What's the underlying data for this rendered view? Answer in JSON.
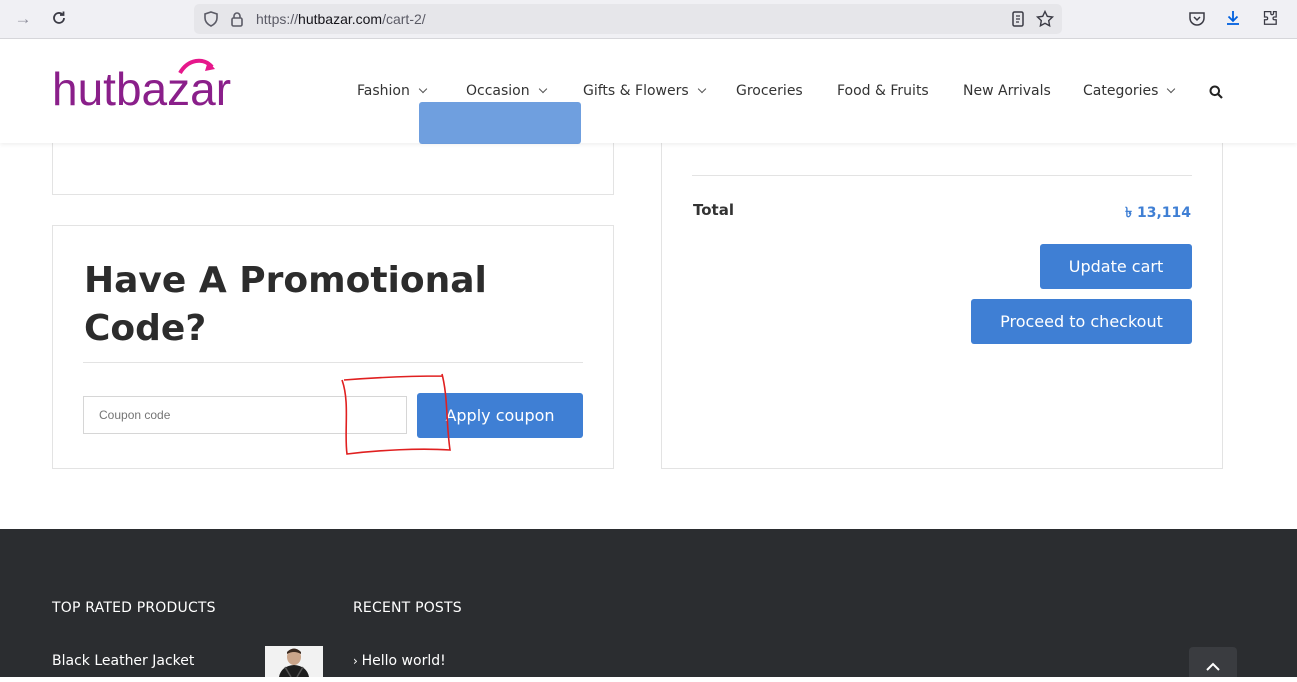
{
  "browser": {
    "url_prefix": "https://",
    "url_host": "hutbazar.com",
    "url_path": "/cart-2/"
  },
  "header": {
    "logo_text": "hutbazar",
    "nav": [
      {
        "label": "Fashion",
        "dropdown": true
      },
      {
        "label": "Occasion",
        "dropdown": true
      },
      {
        "label": "Gifts & Flowers",
        "dropdown": true
      },
      {
        "label": "Groceries",
        "dropdown": false
      },
      {
        "label": "Food & Fruits",
        "dropdown": false
      },
      {
        "label": "New Arrivals",
        "dropdown": false
      },
      {
        "label": "Categories",
        "dropdown": true
      }
    ]
  },
  "promo": {
    "title": "Have A Promotional Code?",
    "coupon_placeholder": "Coupon code",
    "apply_label": "Apply coupon"
  },
  "totals": {
    "total_label": "Total",
    "total_value": "৳ 13,114",
    "update_cart_label": "Update cart",
    "checkout_label": "Proceed to checkout"
  },
  "footer": {
    "top_rated_heading": "TOP RATED PRODUCTS",
    "top_rated_product": "Black Leather Jacket",
    "recent_posts_heading": "RECENT POSTS",
    "recent_post": "Hello world!"
  },
  "colors": {
    "accent": "#3f7fd4",
    "brand_purple": "#8a1f8a",
    "brand_pink": "#e6178b",
    "footer_bg": "#2b2d30",
    "annotation_red": "#e02020"
  }
}
